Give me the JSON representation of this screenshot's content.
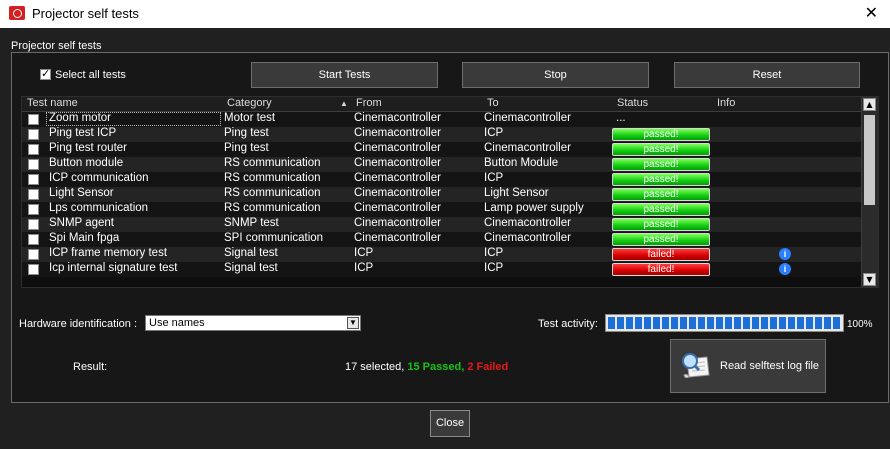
{
  "window": {
    "title": "Projector self tests",
    "close_glyph": "✕"
  },
  "group_label": "Projector self tests",
  "select_all": {
    "label": "Select all tests",
    "checked": true
  },
  "buttons": {
    "start": "Start Tests",
    "stop": "Stop",
    "reset": "Reset",
    "close": "Close"
  },
  "table": {
    "headers": {
      "name": "Test name",
      "category": "Category",
      "from": "From",
      "to": "To",
      "status": "Status",
      "info": "Info"
    },
    "rows": [
      {
        "name": "Zoom motor",
        "category": "Motor test",
        "from": "Cinemacontroller",
        "to": "Cinemacontroller",
        "status": "...",
        "info": false
      },
      {
        "name": "Ping test ICP",
        "category": "Ping test",
        "from": "Cinemacontroller",
        "to": "ICP",
        "status": "passed!",
        "info": false
      },
      {
        "name": "Ping test router",
        "category": "Ping test",
        "from": "Cinemacontroller",
        "to": "Cinemacontroller",
        "status": "passed!",
        "info": false
      },
      {
        "name": "Button module",
        "category": "RS communication",
        "from": "Cinemacontroller",
        "to": "Button Module",
        "status": "passed!",
        "info": false
      },
      {
        "name": "ICP communication",
        "category": "RS communication",
        "from": "Cinemacontroller",
        "to": "ICP",
        "status": "passed!",
        "info": false
      },
      {
        "name": "Light Sensor",
        "category": "RS communication",
        "from": "Cinemacontroller",
        "to": "Light Sensor",
        "status": "passed!",
        "info": false
      },
      {
        "name": "Lps communication",
        "category": "RS communication",
        "from": "Cinemacontroller",
        "to": "Lamp power supply",
        "status": "passed!",
        "info": false
      },
      {
        "name": "SNMP agent",
        "category": "SNMP test",
        "from": "Cinemacontroller",
        "to": "Cinemacontroller",
        "status": "passed!",
        "info": false
      },
      {
        "name": "Spi Main fpga",
        "category": "SPI communication",
        "from": "Cinemacontroller",
        "to": "Cinemacontroller",
        "status": "passed!",
        "info": false
      },
      {
        "name": "ICP frame memory test",
        "category": "Signal test",
        "from": "ICP",
        "to": "ICP",
        "status": "failed!",
        "info": true
      },
      {
        "name": "Icp internal signature test",
        "category": "Signal test",
        "from": "ICP",
        "to": "ICP",
        "status": "failed!",
        "info": true
      }
    ]
  },
  "hardware": {
    "label": "Hardware identification :",
    "value": "Use names"
  },
  "activity": {
    "label": "Test activity:",
    "percent_text": "100%",
    "progress_fraction": 1.0
  },
  "result": {
    "label": "Result:",
    "selected": "17 selected, ",
    "passed": "15 Passed, ",
    "failed": "2 Failed"
  },
  "log_button": {
    "label": "Read selftest log file"
  },
  "colors": {
    "passed": "#11cc11",
    "failed": "#d40000",
    "progress": "#1d6fd8"
  },
  "icons": {
    "app": "projector-icon",
    "info": "info-icon",
    "log": "magnifier-scroll-icon"
  }
}
